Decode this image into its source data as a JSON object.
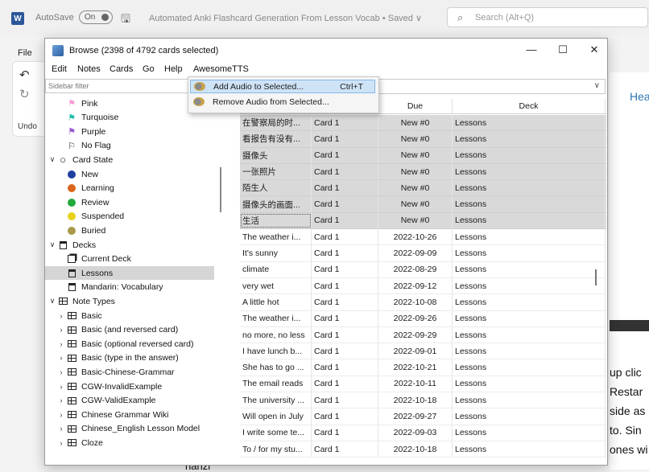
{
  "word": {
    "logo_letter": "W",
    "autosave_label": "AutoSave",
    "autosave_state": "On",
    "doc_title": "Automated Anki Flashcard Generation From Lesson Vocab • Saved ∨",
    "search_placeholder": "Search (Alt+Q)",
    "file_tab": "File",
    "undo_label": "Undo",
    "heading_partial": "Hea",
    "snippets": [
      "up clic",
      "Restar",
      "side as",
      "to. Sin",
      "ones wi"
    ],
    "hanzi_tail": "hanzi"
  },
  "browse": {
    "title": "Browse (2398 of 4792 cards selected)",
    "menus": [
      "Edit",
      "Notes",
      "Cards",
      "Go",
      "Help",
      "AwesomeTTS"
    ],
    "sidebar_filter_placeholder": "Sidebar filter",
    "sidebar": [
      {
        "label": "Pink",
        "icon": "flag-icon",
        "color": "#f59bd6",
        "indent": 2,
        "chev": ""
      },
      {
        "label": "Turquoise",
        "icon": "flag-icon",
        "color": "#1fbfb0",
        "indent": 2,
        "chev": ""
      },
      {
        "label": "Purple",
        "icon": "flag-icon",
        "color": "#9b59d0",
        "indent": 2,
        "chev": ""
      },
      {
        "label": "No Flag",
        "icon": "flag-outline-icon",
        "color": "#222222",
        "indent": 2,
        "chev": ""
      },
      {
        "label": "Card State",
        "icon": "circle-outline-icon",
        "color": "#222222",
        "indent": 0,
        "chev": "v"
      },
      {
        "label": "New",
        "icon": "dot-icon",
        "color": "#1c3fa0",
        "indent": 2,
        "chev": ""
      },
      {
        "label": "Learning",
        "icon": "dot-icon",
        "color": "#d8661c",
        "indent": 2,
        "chev": ""
      },
      {
        "label": "Review",
        "icon": "dot-icon",
        "color": "#22a83a",
        "indent": 2,
        "chev": ""
      },
      {
        "label": "Suspended",
        "icon": "dot-icon",
        "color": "#e8d21a",
        "indent": 2,
        "chev": ""
      },
      {
        "label": "Buried",
        "icon": "dot-icon",
        "color": "#a89a4a",
        "indent": 2,
        "chev": ""
      },
      {
        "label": "Decks",
        "icon": "deck-icon",
        "color": "#222222",
        "indent": 0,
        "chev": "v"
      },
      {
        "label": "Current Deck",
        "icon": "current-deck-icon",
        "color": "#222222",
        "indent": 2,
        "chev": ""
      },
      {
        "label": "Lessons",
        "icon": "deck-icon",
        "color": "#222222",
        "indent": 2,
        "chev": "",
        "selected": true
      },
      {
        "label": "Mandarin: Vocabulary",
        "icon": "deck-icon",
        "color": "#222222",
        "indent": 2,
        "chev": ""
      },
      {
        "label": "Note Types",
        "icon": "notetype-icon",
        "color": "#222222",
        "indent": 0,
        "chev": "v"
      },
      {
        "label": "Basic",
        "icon": "notetype-icon",
        "color": "#222222",
        "indent": 1,
        "chev": ">"
      },
      {
        "label": "Basic (and reversed card)",
        "icon": "notetype-icon",
        "color": "#222222",
        "indent": 1,
        "chev": ">"
      },
      {
        "label": "Basic (optional reversed card)",
        "icon": "notetype-icon",
        "color": "#222222",
        "indent": 1,
        "chev": ">"
      },
      {
        "label": "Basic (type in the answer)",
        "icon": "notetype-icon",
        "color": "#222222",
        "indent": 1,
        "chev": ">"
      },
      {
        "label": "Basic-Chinese-Grammar",
        "icon": "notetype-icon",
        "color": "#222222",
        "indent": 1,
        "chev": ">"
      },
      {
        "label": "CGW-InvalidExample",
        "icon": "notetype-icon",
        "color": "#222222",
        "indent": 1,
        "chev": ">"
      },
      {
        "label": "CGW-ValidExample",
        "icon": "notetype-icon",
        "color": "#222222",
        "indent": 1,
        "chev": ">"
      },
      {
        "label": "Chinese Grammar Wiki",
        "icon": "notetype-icon",
        "color": "#222222",
        "indent": 1,
        "chev": ">"
      },
      {
        "label": "Chinese_English Lesson Model",
        "icon": "notetype-icon",
        "color": "#222222",
        "indent": 1,
        "chev": ">"
      },
      {
        "label": "Cloze",
        "icon": "notetype-icon",
        "color": "#222222",
        "indent": 1,
        "chev": ">"
      }
    ],
    "columns": [
      "",
      "",
      "Due",
      "Deck"
    ],
    "rows": [
      {
        "sort": "在警察局的时...",
        "card": "Card 1",
        "due": "New #0",
        "deck": "Lessons",
        "selected": true
      },
      {
        "sort": "看报告有没有...",
        "card": "Card 1",
        "due": "New #0",
        "deck": "Lessons",
        "selected": true
      },
      {
        "sort": "摄像头",
        "card": "Card 1",
        "due": "New #0",
        "deck": "Lessons",
        "selected": true
      },
      {
        "sort": "一张照片",
        "card": "Card 1",
        "due": "New #0",
        "deck": "Lessons",
        "selected": true
      },
      {
        "sort": "陌生人",
        "card": "Card 1",
        "due": "New #0",
        "deck": "Lessons",
        "selected": true
      },
      {
        "sort": "摄像头的画面...",
        "card": "Card 1",
        "due": "New #0",
        "deck": "Lessons",
        "selected": true
      },
      {
        "sort": "生活",
        "card": "Card 1",
        "due": "New #0",
        "deck": "Lessons",
        "selected": true,
        "focus": true
      },
      {
        "sort": "The weather i...",
        "card": "Card 1",
        "due": "2022-10-26",
        "deck": "Lessons"
      },
      {
        "sort": "It's sunny",
        "card": "Card 1",
        "due": "2022-09-09",
        "deck": "Lessons"
      },
      {
        "sort": "climate",
        "card": "Card 1",
        "due": "2022-08-29",
        "deck": "Lessons"
      },
      {
        "sort": "very wet",
        "card": "Card 1",
        "due": "2022-09-12",
        "deck": "Lessons"
      },
      {
        "sort": "A little hot",
        "card": "Card 1",
        "due": "2022-10-08",
        "deck": "Lessons"
      },
      {
        "sort": "The weather i...",
        "card": "Card 1",
        "due": "2022-09-26",
        "deck": "Lessons"
      },
      {
        "sort": "no more, no less",
        "card": "Card 1",
        "due": "2022-09-29",
        "deck": "Lessons"
      },
      {
        "sort": "I have lunch b...",
        "card": "Card 1",
        "due": "2022-09-01",
        "deck": "Lessons"
      },
      {
        "sort": "She has to go ...",
        "card": "Card 1",
        "due": "2022-10-21",
        "deck": "Lessons"
      },
      {
        "sort": "The email reads",
        "card": "Card 1",
        "due": "2022-10-11",
        "deck": "Lessons"
      },
      {
        "sort": "The university ...",
        "card": "Card 1",
        "due": "2022-10-18",
        "deck": "Lessons"
      },
      {
        "sort": "Will open in July",
        "card": "Card 1",
        "due": "2022-09-27",
        "deck": "Lessons"
      },
      {
        "sort": "I write some te...",
        "card": "Card 1",
        "due": "2022-09-03",
        "deck": "Lessons"
      },
      {
        "sort": "To / for my stu...",
        "card": "Card 1",
        "due": "2022-10-18",
        "deck": "Lessons"
      }
    ],
    "awesometts_menu": [
      {
        "label": "Add Audio to Selected...",
        "shortcut": "Ctrl+T",
        "highlighted": true
      },
      {
        "label": "Remove Audio from Selected...",
        "shortcut": ""
      }
    ]
  }
}
